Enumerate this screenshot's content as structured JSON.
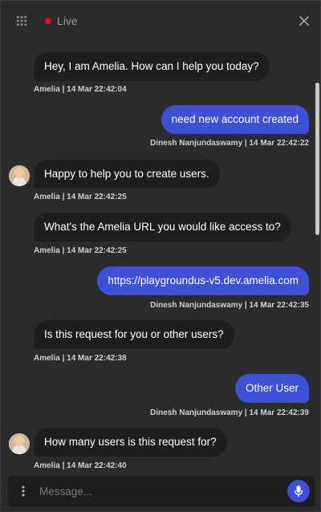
{
  "header": {
    "live_label": "Live",
    "icons": {
      "menu": "grid-icon",
      "close": "close-icon"
    },
    "colors": {
      "live_dot": "#e00b1c"
    }
  },
  "messages": [
    {
      "sender": "bot",
      "text": "Hey, I am Amelia. How can I help you today?",
      "meta": "Amelia | 14 Mar 22:42:04",
      "avatar": false
    },
    {
      "sender": "user",
      "text": "need new account created",
      "meta": "Dinesh Nanjundaswamy | 14 Mar 22:42:22"
    },
    {
      "sender": "bot",
      "text": "Happy to help you to create users.",
      "meta": "Amelia | 14 Mar 22:42:25",
      "avatar": true
    },
    {
      "sender": "bot",
      "text": "What's the Amelia URL you would like access to?",
      "meta": "Amelia | 14 Mar 22:42:25",
      "avatar": false
    },
    {
      "sender": "user",
      "text": "https://playgroundus-v5.dev.amelia.com",
      "meta": "Dinesh Nanjundaswamy | 14 Mar 22:42:35"
    },
    {
      "sender": "bot",
      "text": "Is this request for you or other users?",
      "meta": "Amelia | 14 Mar 22:42:38",
      "avatar": false
    },
    {
      "sender": "user",
      "text": "Other User",
      "meta": "Dinesh Nanjundaswamy | 14 Mar 22:42:39"
    },
    {
      "sender": "bot",
      "text": "How many users is this request for?",
      "meta": "Amelia | 14 Mar 22:42:40",
      "avatar": true
    }
  ],
  "composer": {
    "placeholder": "Message...",
    "icons": {
      "more": "more-vertical-icon",
      "mic": "microphone-icon"
    }
  },
  "colors": {
    "background": "#2b2b2b",
    "bot_bubble": "#1e1e1e",
    "user_bubble": "#3d50d6",
    "accent": "#3d50d6"
  }
}
